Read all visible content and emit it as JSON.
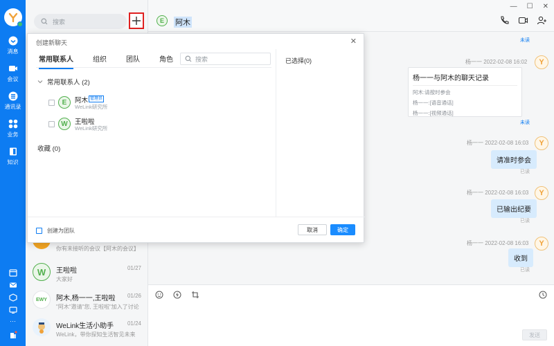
{
  "rail": {
    "items": [
      {
        "label": "消息",
        "icon": "chat-bubble-icon"
      },
      {
        "label": "会议",
        "icon": "video-camera-icon"
      },
      {
        "label": "通讯录",
        "icon": "contacts-icon"
      },
      {
        "label": "业务",
        "icon": "apps-grid-icon"
      },
      {
        "label": "知识",
        "icon": "book-icon"
      }
    ],
    "more": "···"
  },
  "list": {
    "search_placeholder": "搜索",
    "conversations": [
      {
        "name": "",
        "date": "",
        "preview": "你有未接听的会议【阿木的会议】",
        "avatar": "",
        "avatar_color": "#f5a623"
      },
      {
        "name": "王啦啦",
        "date": "01/27",
        "preview": "大家好",
        "avatar": "W",
        "avatar_color": "#52b04e"
      },
      {
        "name": "阿木,杨一一,王啦啦",
        "date": "01/26",
        "preview": "\"阿木\"邀请\"您, 王啦啦\"加入了讨论...",
        "avatar": "EWY",
        "avatar_color": "#52b04e"
      },
      {
        "name": "WeLink生活小助手",
        "date": "01/24",
        "preview": "WeLink，带你探知生活智见未来",
        "avatar": "",
        "avatar_color": "#f0a23a"
      }
    ]
  },
  "chat": {
    "title": "阿木",
    "title_avatar": "E",
    "window": {
      "min": "—",
      "max": "☐",
      "close": "✕"
    },
    "messages": [
      {
        "status": "未读"
      },
      {
        "meta": "杨一一  2022-02-08 16:02",
        "card_title": "杨一一与阿木的聊天记录",
        "card_lines": [
          "阿木:请按时参会",
          "杨一一:[语音通话]",
          "杨一一:[视频通话]"
        ],
        "status": "未读"
      },
      {
        "meta": "杨一一  2022-02-08 16:03",
        "text": "请准时参会",
        "status": "已读"
      },
      {
        "meta": "杨一一  2022-02-08 16:03",
        "text": "已输出纪要",
        "status": "已读"
      },
      {
        "meta": "杨一一  2022-02-08 16:03",
        "text": "收到",
        "status": "已读"
      }
    ],
    "sender_avatar": "Y",
    "send_label": "发送"
  },
  "dialog": {
    "title": "创建新聊天",
    "close": "✕",
    "tabs": [
      "常用联系人",
      "组织",
      "团队",
      "角色"
    ],
    "search_placeholder": "搜索",
    "selected_title": "已选择(0)",
    "group_title": "常用联系人 (2)",
    "contacts": [
      {
        "name": "阿木",
        "org": "WeLink研究所",
        "avatar": "E",
        "badge": "管理员"
      },
      {
        "name": "王啦啦",
        "org": "WeLink研究所",
        "avatar": "W",
        "badge": ""
      }
    ],
    "favorites": "收藏 (0)",
    "create_team": "创建为团队",
    "cancel": "取消",
    "ok": "确定"
  },
  "colors": {
    "brand": "#0d7cf2",
    "primary_button": "#1a8cff",
    "highlight_border": "#e02020"
  }
}
